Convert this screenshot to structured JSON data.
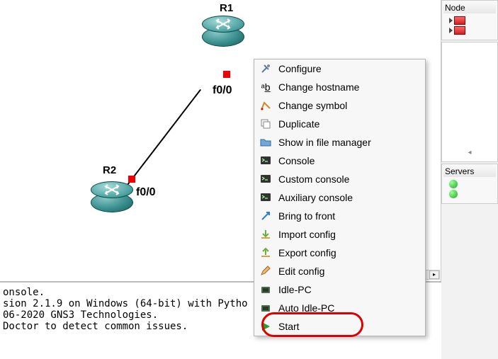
{
  "routers": {
    "r1": {
      "label": "R1",
      "interface": "f0/0"
    },
    "r2": {
      "label": "R2",
      "interface": "f0/0"
    }
  },
  "context_menu": {
    "items": [
      {
        "icon": "tools-icon",
        "glyph": "🛠",
        "label": "Configure"
      },
      {
        "icon": "rename-icon",
        "glyph": "ᵃb̲",
        "label": "Change hostname"
      },
      {
        "icon": "symbol-icon",
        "glyph": "✎",
        "label": "Change symbol"
      },
      {
        "icon": "duplicate-icon",
        "glyph": "⧉",
        "label": "Duplicate"
      },
      {
        "icon": "folder-icon",
        "glyph": "📁",
        "label": "Show in file manager"
      },
      {
        "icon": "console-icon",
        "glyph": "▣",
        "label": "Console"
      },
      {
        "icon": "custom-console-icon",
        "glyph": "▥",
        "label": "Custom console"
      },
      {
        "icon": "aux-console-icon",
        "glyph": "▤",
        "label": "Auxiliary console"
      },
      {
        "icon": "bring-front-icon",
        "glyph": "↗",
        "label": "Bring to front"
      },
      {
        "icon": "import-icon",
        "glyph": "⇩",
        "label": "Import config"
      },
      {
        "icon": "export-icon",
        "glyph": "⇧",
        "label": "Export config"
      },
      {
        "icon": "edit-icon",
        "glyph": "✏",
        "label": "Edit config"
      },
      {
        "icon": "idle-icon",
        "glyph": "⏱",
        "label": "Idle-PC"
      },
      {
        "icon": "auto-idle-icon",
        "glyph": "⏱",
        "label": "Auto Idle-PC"
      },
      {
        "icon": "start-icon",
        "glyph": "▶",
        "label": "Start"
      }
    ]
  },
  "right_panel": {
    "node_title": "Node",
    "servers_title": "Servers"
  },
  "console_log": {
    "lines": [
      "onsole.",
      "sion 2.1.9 on Windows (64-bit) with Pytho",
      "06-2020 GNS3 Technologies.",
      "Doctor to detect common issues."
    ]
  },
  "colors": {
    "highlight": "#d00"
  }
}
